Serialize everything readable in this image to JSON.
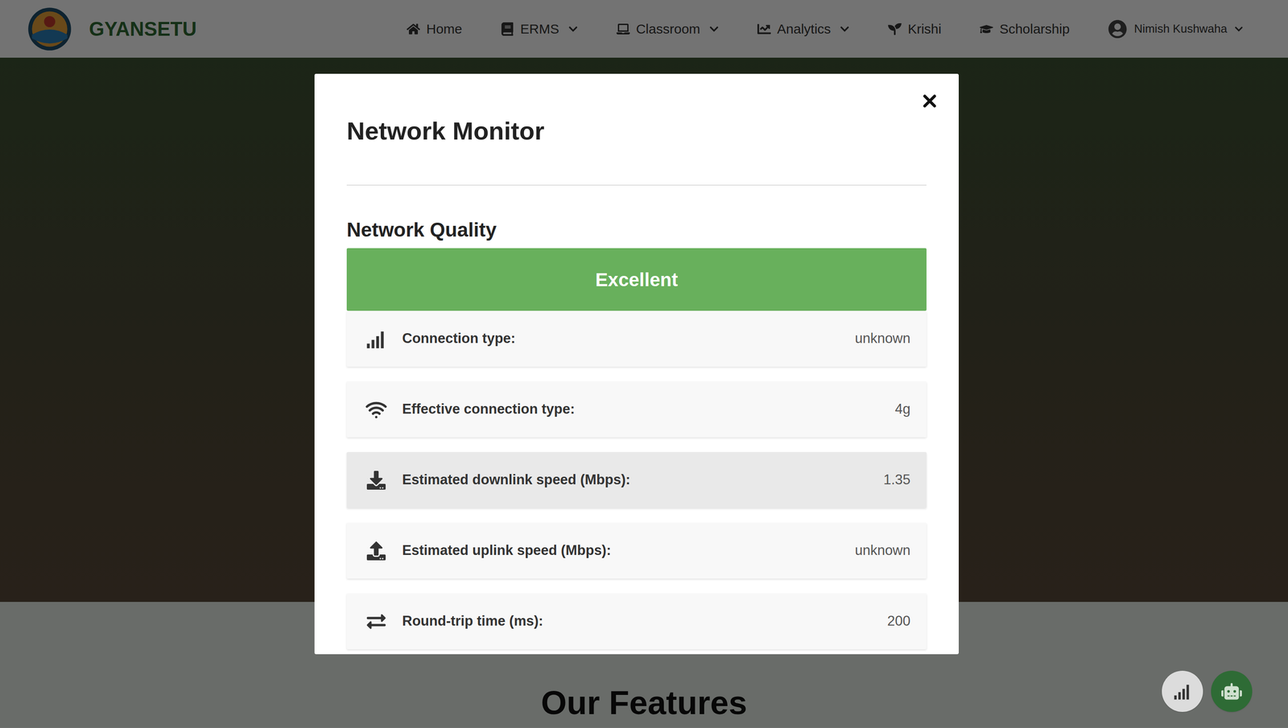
{
  "navbar": {
    "brand": "GYANSETU",
    "items": [
      {
        "label": "Home",
        "dropdown": false
      },
      {
        "label": "ERMS",
        "dropdown": true
      },
      {
        "label": "Classroom",
        "dropdown": true
      },
      {
        "label": "Analytics",
        "dropdown": true
      },
      {
        "label": "Krishi",
        "dropdown": false
      },
      {
        "label": "Scholarship",
        "dropdown": false
      }
    ],
    "user": {
      "name": "Nimish Kushwaha",
      "dropdown": true
    }
  },
  "modal": {
    "title": "Network Monitor",
    "section": "Network Quality",
    "quality": "Excellent",
    "rows": [
      {
        "label": "Connection type:",
        "value": "unknown",
        "highlighted": false
      },
      {
        "label": "Effective connection type:",
        "value": "4g",
        "highlighted": false
      },
      {
        "label": "Estimated downlink speed (Mbps):",
        "value": "1.35",
        "highlighted": true
      },
      {
        "label": "Estimated uplink speed (Mbps):",
        "value": "unknown",
        "highlighted": false
      },
      {
        "label": "Round-trip time (ms):",
        "value": "200",
        "highlighted": false
      }
    ]
  },
  "page": {
    "section_title": "Our Features"
  }
}
